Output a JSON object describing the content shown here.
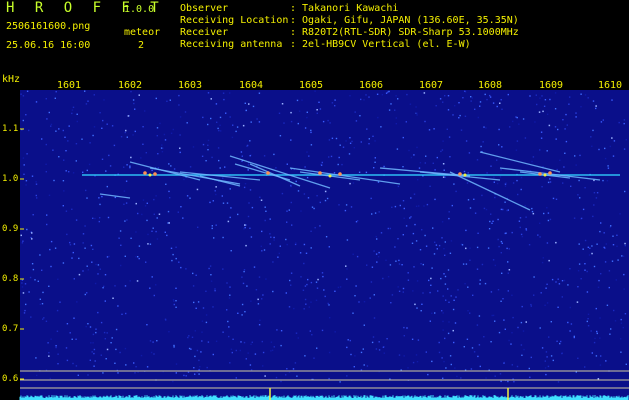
{
  "header": {
    "app_name": "H R O F F T",
    "version": "1.0.0",
    "filename": "2506161600.png",
    "datetime": "25.06.16 16:00",
    "meteor_label": "meteor",
    "meteor_count": "2",
    "info": [
      {
        "key": "Observer",
        "value": ": Takanori Kawachi"
      },
      {
        "key": "Receiving Location",
        "value": ": Ogaki, Gifu, JAPAN (136.60E, 35.35N)"
      },
      {
        "key": "Receiver",
        "value": ": R820T2(RTL-SDR) SDR-Sharp 53.1000MHz"
      },
      {
        "key": "Receiving antenna",
        "value": ": 2el-HB9CV Vertical (el. E-W)"
      }
    ]
  },
  "plot": {
    "unit": "kHz",
    "x_ticks": [
      "1601",
      "1602",
      "1603",
      "1604",
      "1605",
      "1606",
      "1607",
      "1608",
      "1609",
      "1610"
    ],
    "y_ticks": [
      "1.1",
      "1.0",
      "0.9",
      "0.8",
      "0.7",
      "0.6"
    ],
    "colors": {
      "background": "#0a0f8a",
      "carrier": "#30d0ff",
      "label": "#f4f000",
      "baseline": "#40e0ff",
      "guide": "#d0c8a0"
    }
  }
}
